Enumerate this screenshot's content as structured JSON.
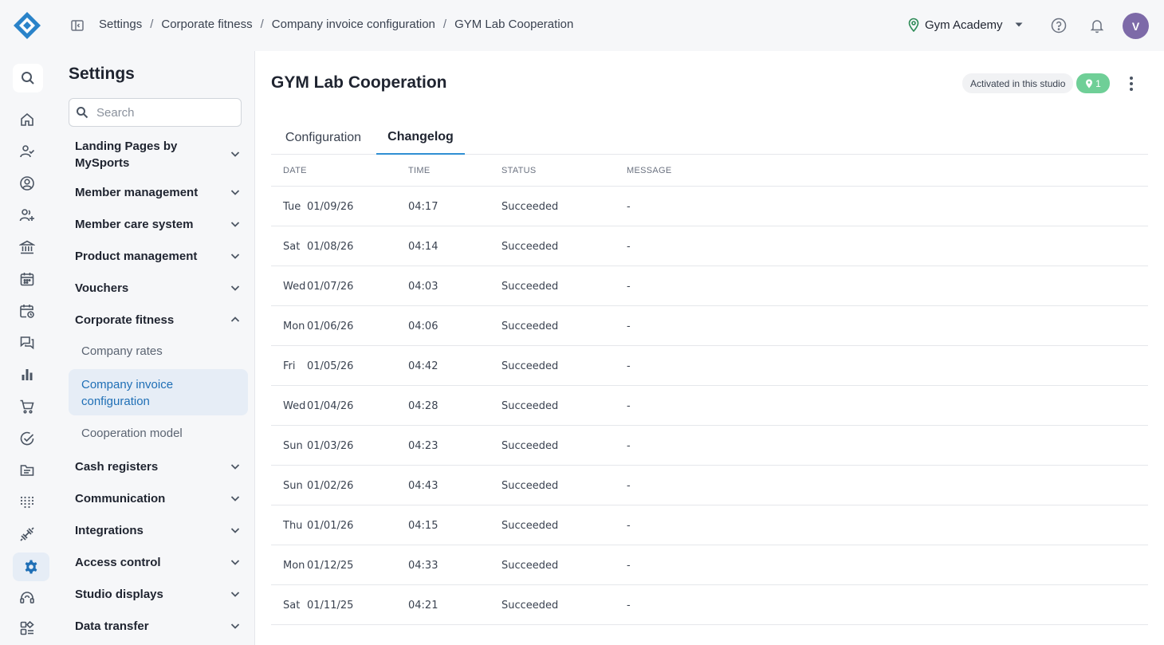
{
  "breadcrumb": [
    "Settings",
    "Corporate fitness",
    "Company invoice configuration",
    "GYM Lab Cooperation"
  ],
  "studio": {
    "name": "Gym Academy"
  },
  "user": {
    "initial": "V"
  },
  "rail": [
    "search-icon",
    "home-icon",
    "check-user-icon",
    "user-circle-icon",
    "add-users-icon",
    "bank-icon",
    "calendar-icon",
    "calendar-clock-icon",
    "chat-icon",
    "bar-chart-icon",
    "cart-icon",
    "check-circle-icon",
    "folder-icon",
    "dots-grid-icon",
    "dumbbell-icon",
    "settings-icon",
    "headset-icon",
    "apps-icon"
  ],
  "settings": {
    "title": "Settings",
    "search_placeholder": "Search",
    "items": [
      {
        "label": "Landing Pages by MySports"
      },
      {
        "label": "Member management"
      },
      {
        "label": "Member care system"
      },
      {
        "label": "Product management"
      },
      {
        "label": "Vouchers"
      },
      {
        "label": "Corporate fitness"
      },
      {
        "label": "Cash registers"
      },
      {
        "label": "Communication"
      },
      {
        "label": "Integrations"
      },
      {
        "label": "Access control"
      },
      {
        "label": "Studio displays"
      },
      {
        "label": "Data transfer"
      }
    ],
    "sub_items": [
      {
        "label": "Company rates"
      },
      {
        "label": "Company invoice configuration"
      },
      {
        "label": "Cooperation model"
      }
    ]
  },
  "main": {
    "title": "GYM Lab Cooperation",
    "activated_label": "Activated in this studio",
    "location_count": "1",
    "tabs": [
      "Configuration",
      "Changelog"
    ],
    "active_tab": "Changelog",
    "columns": [
      "DATE",
      "TIME",
      "STATUS",
      "MESSAGE"
    ],
    "rows": [
      {
        "day": "Tue",
        "date": "01/09/26",
        "time": "04:17",
        "status": "Succeeded",
        "message": "-"
      },
      {
        "day": "Sat",
        "date": "01/08/26",
        "time": "04:14",
        "status": "Succeeded",
        "message": "-"
      },
      {
        "day": "Wed",
        "date": "01/07/26",
        "time": "04:03",
        "status": "Succeeded",
        "message": "-"
      },
      {
        "day": "Mon",
        "date": "01/06/26",
        "time": "04:06",
        "status": "Succeeded",
        "message": "-"
      },
      {
        "day": "Fri",
        "date": "01/05/26",
        "time": "04:42",
        "status": "Succeeded",
        "message": "-"
      },
      {
        "day": "Wed",
        "date": "01/04/26",
        "time": "04:28",
        "status": "Succeeded",
        "message": "-"
      },
      {
        "day": "Sun",
        "date": "01/03/26",
        "time": "04:23",
        "status": "Succeeded",
        "message": "-"
      },
      {
        "day": "Sun",
        "date": "01/02/26",
        "time": "04:43",
        "status": "Succeeded",
        "message": "-"
      },
      {
        "day": "Thu",
        "date": "01/01/26",
        "time": "04:15",
        "status": "Succeeded",
        "message": "-"
      },
      {
        "day": "Mon",
        "date": "01/12/25",
        "time": "04:33",
        "status": "Succeeded",
        "message": "-"
      },
      {
        "day": "Sat",
        "date": "01/11/25",
        "time": "04:21",
        "status": "Succeeded",
        "message": "-"
      }
    ]
  },
  "colors": {
    "accent": "#1f6fb6",
    "tab_underline": "#2f8fd3",
    "success_badge": "#6fcf97",
    "avatar": "#7d6aa8"
  }
}
